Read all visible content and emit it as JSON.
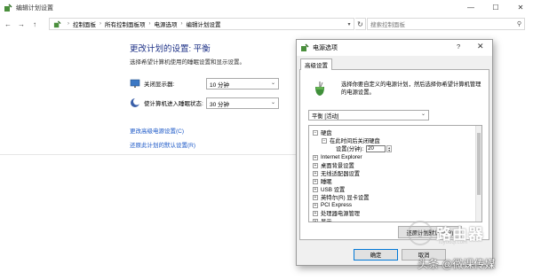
{
  "window": {
    "title": "编辑计划设置",
    "controls": {
      "minimize": "—",
      "maximize": "☐",
      "close": "✕"
    }
  },
  "addressbar": {
    "nav": {
      "back": "←",
      "forward": "→",
      "up": "↑"
    },
    "crumbs": [
      "控制面板",
      "所有控制面板项",
      "电源选项",
      "编辑计划设置"
    ],
    "refresh": "↻",
    "search_placeholder": "搜索控制面板"
  },
  "page": {
    "heading": "更改计划的设置: 平衡",
    "subtitle": "选择希望计算机使用的睡眠设置和显示设置。",
    "settings": [
      {
        "label": "关闭显示器:",
        "value": "10 分钟",
        "icon": "monitor-icon"
      },
      {
        "label": "使计算机进入睡眠状态:",
        "value": "30 分钟",
        "icon": "moon-icon"
      }
    ],
    "links": [
      "更改高级电源设置(C)",
      "还原此计划的默认设置(R)"
    ]
  },
  "dialog": {
    "title": "电源选项",
    "help": "?",
    "close": "✕",
    "tab": "高级设置",
    "description": "选择你要自定义的电源计划，然后选择你希望计算机管理的电源设置。",
    "plan": "平衡 [活动]",
    "tree": {
      "disk": "硬盘",
      "disk_sub": "在此时间后关闭硬盘",
      "disk_setting_label": "设置(分钟):",
      "disk_setting_value": "20",
      "items": [
        "Internet Explorer",
        "桌面背景设置",
        "无线适配器设置",
        "睡眠",
        "USB 设置",
        "英特尔(R) 显卡设置",
        "PCI Express",
        "处理器电源管理",
        "显示"
      ]
    },
    "restore_button": "还原计划默认值(R)",
    "ok": "确定",
    "cancel": "取消"
  },
  "watermarks": {
    "logo": "路由器",
    "url": "luyouqi.com",
    "toutiao": "头条 @微课传媒"
  },
  "colors": {
    "link": "#1a57c7",
    "heading": "#1e3287",
    "accent": "#0078d7"
  }
}
